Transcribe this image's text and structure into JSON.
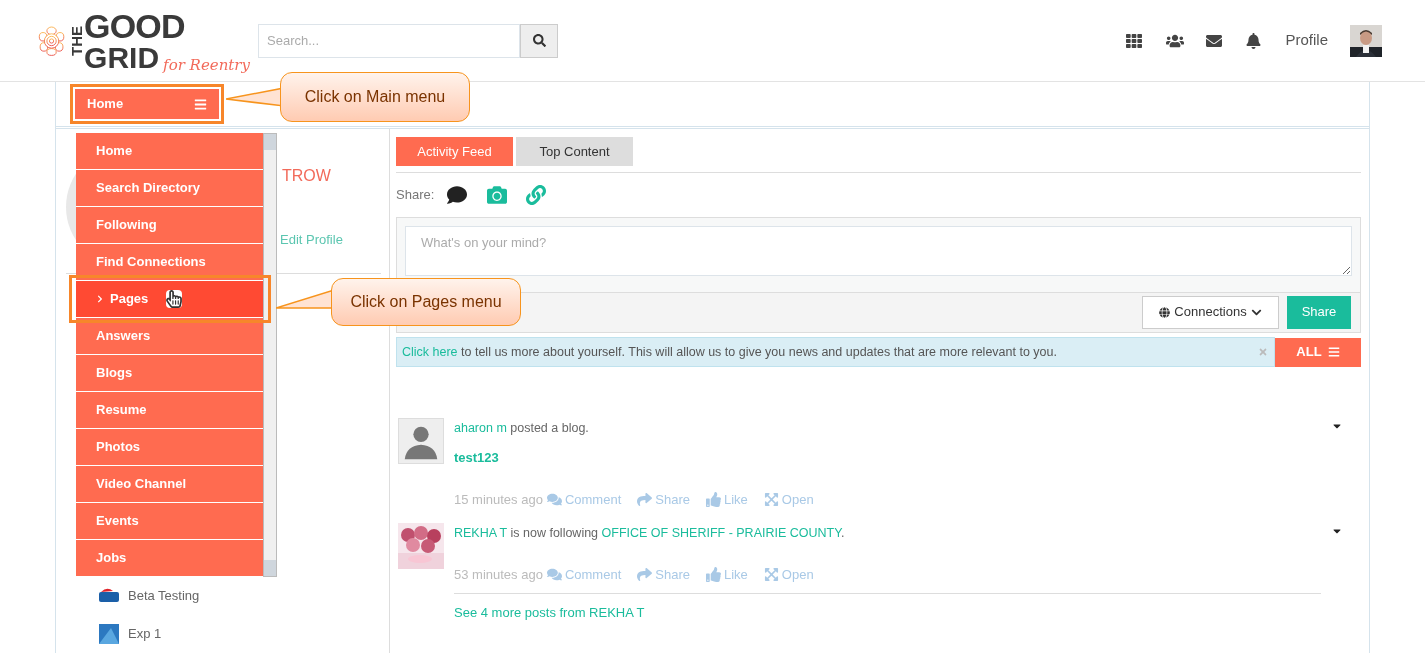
{
  "logo": {
    "line_1": "THE",
    "line_2": "GOOD",
    "line_3": "GRID",
    "tagline": "for Reentry"
  },
  "search": {
    "placeholder": "Search..."
  },
  "header": {
    "profile_label": "Profile"
  },
  "main_menu_button": {
    "label": "Home"
  },
  "main_menu": [
    {
      "label": "Home",
      "selected": false
    },
    {
      "label": "Search Directory",
      "selected": false
    },
    {
      "label": "Following",
      "selected": false
    },
    {
      "label": "Find Connections",
      "selected": false
    },
    {
      "label": "Pages",
      "selected": true
    },
    {
      "label": "Answers",
      "selected": false
    },
    {
      "label": "Blogs",
      "selected": false
    },
    {
      "label": "Resume",
      "selected": false
    },
    {
      "label": "Photos",
      "selected": false
    },
    {
      "label": "Video Channel",
      "selected": false
    },
    {
      "label": "Events",
      "selected": false
    },
    {
      "label": "Jobs",
      "selected": false
    }
  ],
  "callouts": [
    {
      "text": "Click on Main menu"
    },
    {
      "text": "Click on Pages menu"
    }
  ],
  "profile_panel": {
    "name_fragment": "TROW",
    "edit_link": "Edit Profile"
  },
  "pages_list": [
    {
      "label": "Beta Testing"
    },
    {
      "label": "Exp 1"
    }
  ],
  "tabs": [
    {
      "label": "Activity Feed",
      "selected": true
    },
    {
      "label": "Top Content",
      "selected": false
    }
  ],
  "share": {
    "label": "Share:",
    "composer_placeholder": "What's on your mind?",
    "audience_button": "Connections",
    "submit_button": "Share"
  },
  "notice": {
    "link": "Click here",
    "text": " to tell us more about yourself. This will allow us to give you news and updates that are more relevant to you."
  },
  "filter_button": "ALL",
  "posts": [
    {
      "avatar": {
        "kind": "silhouette"
      },
      "segments": [
        {
          "text": "aharon m",
          "link": true
        },
        {
          "text": " posted a blog.",
          "link": false
        }
      ],
      "title": "test123",
      "time": "15 minutes ago",
      "actions": [
        {
          "label": "Comment",
          "kind": "comment"
        },
        {
          "label": "Share",
          "kind": "share"
        },
        {
          "label": "Like",
          "kind": "like"
        },
        {
          "label": "Open",
          "kind": "open"
        }
      ]
    },
    {
      "segments": [
        {
          "text": "REKHA T",
          "link": true
        },
        {
          "text": " is now following ",
          "link": false
        },
        {
          "text": "OFFICE OF SHERIFF - PRAIRIE COUNTY",
          "link": true
        },
        {
          "text": ".",
          "link": false
        }
      ],
      "time": "53 minutes ago",
      "actions": [
        {
          "label": "Comment",
          "kind": "comment"
        },
        {
          "label": "Share",
          "kind": "share"
        },
        {
          "label": "Like",
          "kind": "like"
        },
        {
          "label": "Open",
          "kind": "open"
        }
      ],
      "more_link": "See 4 more posts from REKHA T"
    }
  ]
}
